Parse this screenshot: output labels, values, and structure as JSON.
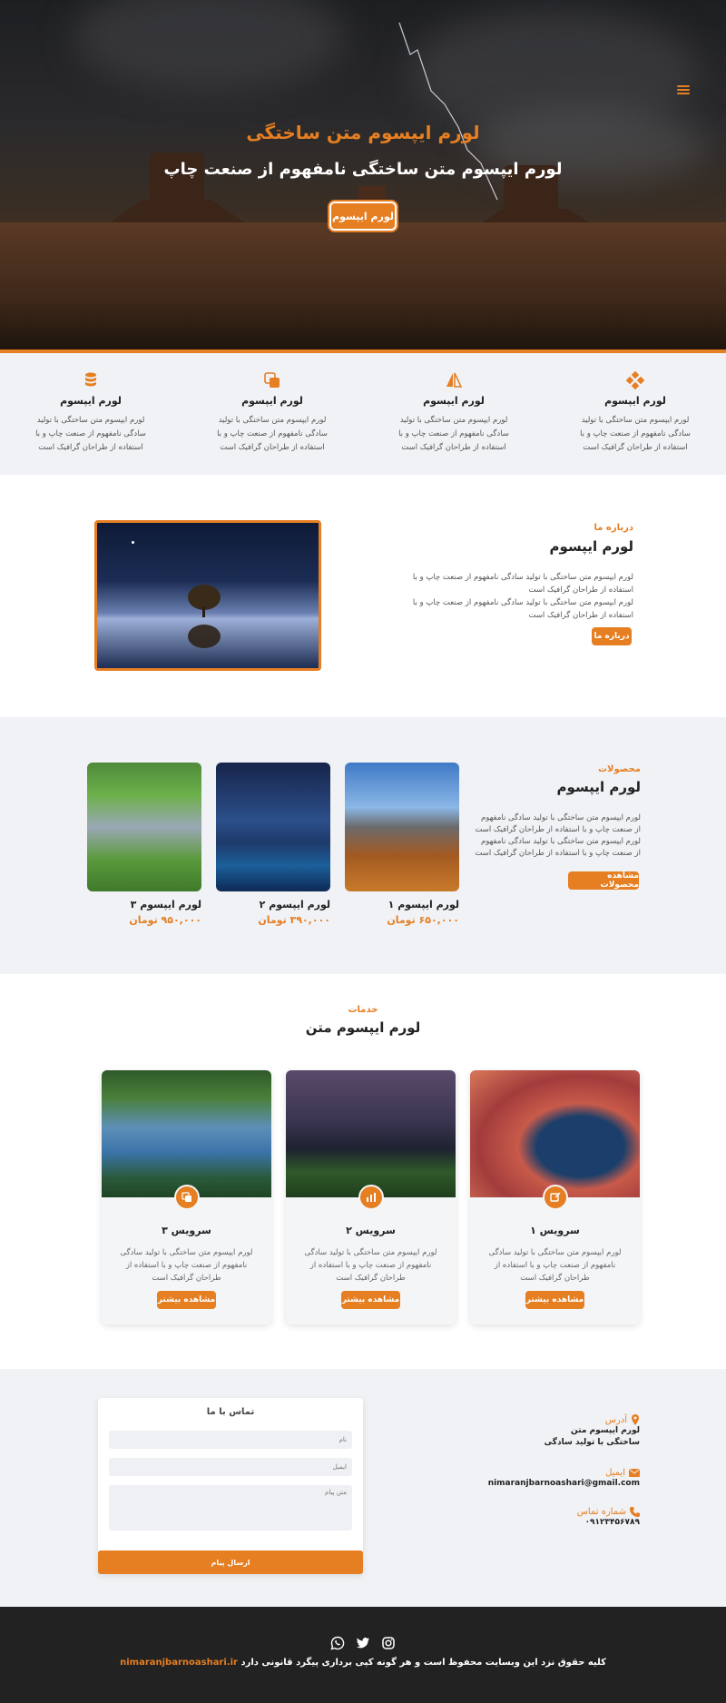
{
  "hero": {
    "title": "لورم ایپسوم متن ساختگی",
    "subtitle": "لورم ایپسوم متن ساختگی نامفهوم از صنعت چاپ",
    "button": "لورم ایپسوم"
  },
  "features": [
    {
      "title": "لورم ایپسوم",
      "text": "لورم ایپسوم متن ساختگی با تولید سادگی نامفهوم از صنعت چاپ و با استفاده از طراحان گرافیک است",
      "icon": "puzzle-icon"
    },
    {
      "title": "لورم ایپسوم",
      "text": "لورم ایپسوم متن ساختگی با تولید سادگی نامفهوم از صنعت چاپ و با استفاده از طراحان گرافیک است",
      "icon": "triangle-icon"
    },
    {
      "title": "لورم ایپسوم",
      "text": "لورم ایپسوم متن ساختگی با تولید سادگی نامفهوم از صنعت چاپ و با استفاده از طراحان گرافیک است",
      "icon": "copy-icon"
    },
    {
      "title": "لورم ایپسوم",
      "text": "لورم ایپسوم متن ساختگی با تولید سادگی نامفهوم از صنعت چاپ و با استفاده از طراحان گرافیک است",
      "icon": "database-icon"
    }
  ],
  "about": {
    "kicker": "درباره ما",
    "title": "لورم ایپسوم",
    "para1": "لورم ایپسوم متن ساختگی با تولید سادگی نامفهوم از صنعت چاپ و با استفاده از طراحان گرافیک است",
    "para2": "لورم ایپسوم متن ساختگی با تولید سادگی نامفهوم از صنعت چاپ و با استفاده از طراحان گرافیک است",
    "button": "درباره ما"
  },
  "products": {
    "kicker": "محصولات",
    "title": "لورم ایپسوم",
    "text": "لورم ایپسوم متن ساختگی با تولید سادگی نامفهوم از صنعت چاپ و با استفاده از طراحان گرافیک است لورم ایپسوم متن ساختگی با تولید سادگی نامفهوم از صنعت چاپ و با استفاده از طراحان گرافیک است",
    "button": "مشاهده محصولات",
    "items": [
      {
        "name": "لورم ایپسوم ۱",
        "price": "۶۵۰,۰۰۰ تومان"
      },
      {
        "name": "لورم ایپسوم ۲",
        "price": "۳۹۰,۰۰۰ تومان"
      },
      {
        "name": "لورم ایپسوم ۳",
        "price": "۹۵۰,۰۰۰ تومان"
      }
    ]
  },
  "services": {
    "kicker": "خدمات",
    "title": "لورم ایپسوم متن",
    "items": [
      {
        "title": "سرویس ۱",
        "text": "لورم ایپسوم متن ساختگی با تولید سادگی نامفهوم از صنعت چاپ و با استفاده از طراحان گرافیک است",
        "button": "مشاهده بیشتر"
      },
      {
        "title": "سرویس ۲",
        "text": "لورم ایپسوم متن ساختگی با تولید سادگی نامفهوم از صنعت چاپ و با استفاده از طراحان گرافیک است",
        "button": "مشاهده بیشتر"
      },
      {
        "title": "سرویس ۳",
        "text": "لورم ایپسوم متن ساختگی با تولید سادگی نامفهوم از صنعت چاپ و با استفاده از طراحان گرافیک است",
        "button": "مشاهده بیشتر"
      }
    ]
  },
  "contact": {
    "form_title": "تماس با ما",
    "name_placeholder": "نام",
    "email_placeholder": "ایمیل",
    "message_placeholder": "متن پیام",
    "submit": "ارسال پیام",
    "address_label": "آدرس",
    "address_line1": "لورم ایپسوم متن",
    "address_line2": "ساختگی با تولید سادگی",
    "email_label": "ایمیل",
    "email_value": "nimaranjbarnoashari@gmail.com",
    "phone_label": "شماره تماس",
    "phone_value": "۰۹۱۲۳۴۵۶۷۸۹"
  },
  "footer": {
    "site": "nimaranjbarnoashari.ir",
    "copyright": "کلیه حقوق نزد این وبسایت محفوظ است و هر گونه کپی برداری پیگرد قانونی دارد"
  },
  "colors": {
    "accent": "#e67e22",
    "footer_bg": "#222222",
    "section_bg": "#f0f2f5"
  }
}
